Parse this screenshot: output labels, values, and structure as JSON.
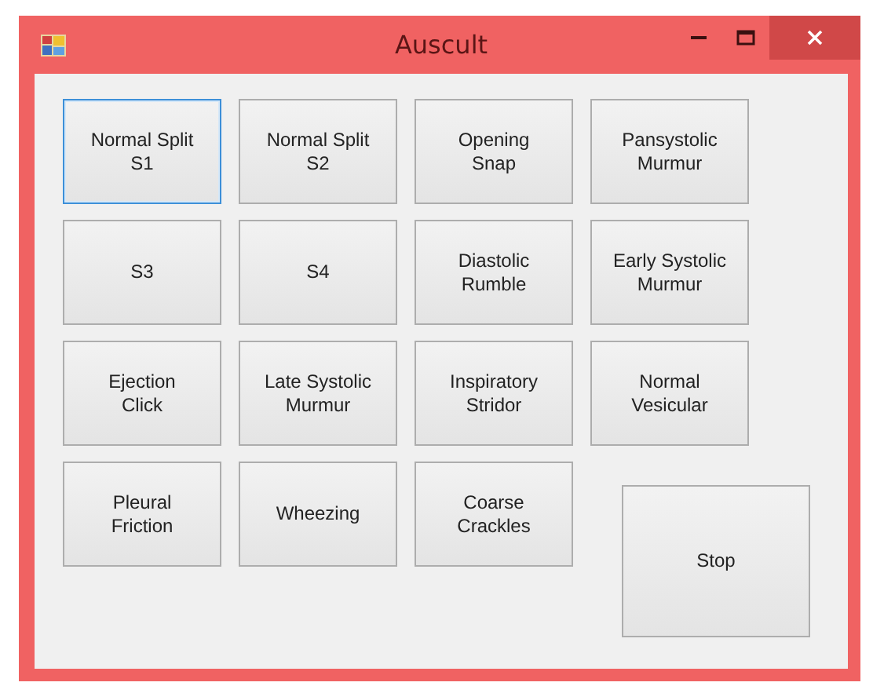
{
  "window": {
    "title": "Auscult"
  },
  "buttons": [
    {
      "label": "Normal Split\nS1",
      "focused": true
    },
    {
      "label": "Normal Split\nS2",
      "focused": false
    },
    {
      "label": "Opening\nSnap",
      "focused": false
    },
    {
      "label": "Pansystolic\nMurmur",
      "focused": false
    },
    {
      "label": "S3",
      "focused": false
    },
    {
      "label": "S4",
      "focused": false
    },
    {
      "label": "Diastolic\nRumble",
      "focused": false
    },
    {
      "label": "Early Systolic\nMurmur",
      "focused": false
    },
    {
      "label": "Ejection\nClick",
      "focused": false
    },
    {
      "label": "Late Systolic\nMurmur",
      "focused": false
    },
    {
      "label": "Inspiratory\nStridor",
      "focused": false
    },
    {
      "label": "Normal\nVesicular",
      "focused": false
    },
    {
      "label": "Pleural\nFriction",
      "focused": false
    },
    {
      "label": "Wheezing",
      "focused": false
    },
    {
      "label": "Coarse\nCrackles",
      "focused": false
    }
  ],
  "stop_button": {
    "label": "Stop"
  }
}
